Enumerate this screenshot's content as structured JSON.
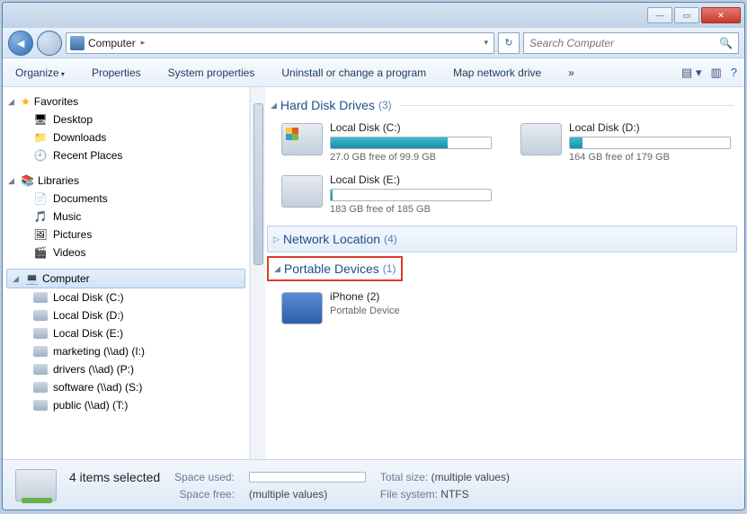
{
  "breadcrumb": {
    "root": "Computer"
  },
  "search": {
    "placeholder": "Search Computer"
  },
  "toolbar": {
    "organize": "Organize",
    "properties": "Properties",
    "sysprops": "System properties",
    "uninstall": "Uninstall or change a program",
    "mapdrive": "Map network drive"
  },
  "sidebar": {
    "favorites": {
      "label": "Favorites",
      "items": [
        "Desktop",
        "Downloads",
        "Recent Places"
      ]
    },
    "libraries": {
      "label": "Libraries",
      "items": [
        "Documents",
        "Music",
        "Pictures",
        "Videos"
      ]
    },
    "computer": {
      "label": "Computer",
      "items": [
        "Local Disk (C:)",
        "Local Disk (D:)",
        "Local Disk (E:)",
        "marketing (\\\\ad) (I:)",
        "drivers (\\\\ad) (P:)",
        "software (\\\\ad) (S:)",
        "public (\\\\ad) (T:)"
      ]
    }
  },
  "groups": {
    "hdd": {
      "label": "Hard Disk Drives",
      "count": "(3)"
    },
    "net": {
      "label": "Network Location",
      "count": "(4)"
    },
    "port": {
      "label": "Portable Devices",
      "count": "(1)"
    }
  },
  "drives": {
    "c": {
      "name": "Local Disk (C:)",
      "free": "27.0 GB free of 99.9 GB",
      "pct": 73
    },
    "d": {
      "name": "Local Disk (D:)",
      "free": "164 GB free of 179 GB",
      "pct": 8
    },
    "e": {
      "name": "Local Disk (E:)",
      "free": "183 GB free of 185 GB",
      "pct": 1
    }
  },
  "portable": {
    "name": "iPhone (2)",
    "sub": "Portable Device"
  },
  "status": {
    "selected": "4 items selected",
    "spaceused_lbl": "Space used:",
    "spacefree_lbl": "Space free:",
    "spacefree": "(multiple values)",
    "totalsize_lbl": "Total size:",
    "totalsize": "(multiple values)",
    "fs_lbl": "File system:",
    "fs": "NTFS"
  }
}
